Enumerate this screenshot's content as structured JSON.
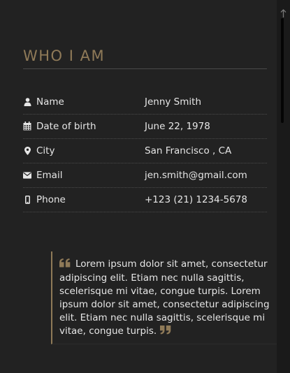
{
  "section": {
    "title": "WHO I AM"
  },
  "info": {
    "rows": [
      {
        "icon": "user-icon",
        "label": "Name",
        "value": "Jenny Smith"
      },
      {
        "icon": "calendar-icon",
        "label": "Date of birth",
        "value": "June 22, 1978"
      },
      {
        "icon": "map-pin-icon",
        "label": "City",
        "value": "San Francisco , CA"
      },
      {
        "icon": "envelope-icon",
        "label": "Email",
        "value": "jen.smith@gmail.com"
      },
      {
        "icon": "mobile-phone-icon",
        "label": "Phone",
        "value": "+123 (21) 1234-5678"
      }
    ]
  },
  "quote": {
    "text": "Lorem ipsum dolor sit amet, consectetur adipiscing elit. Etiam nec nulla sagittis, scelerisque mi vitae, congue turpis. Lorem ipsum dolor sit amet, consectetur adipiscing elit. Etiam nec nulla sagittis, scelerisque mi vitae, congue turpis."
  },
  "colors": {
    "accent": "#8f7a58",
    "background": "#222222",
    "text": "#e6e6e6"
  }
}
